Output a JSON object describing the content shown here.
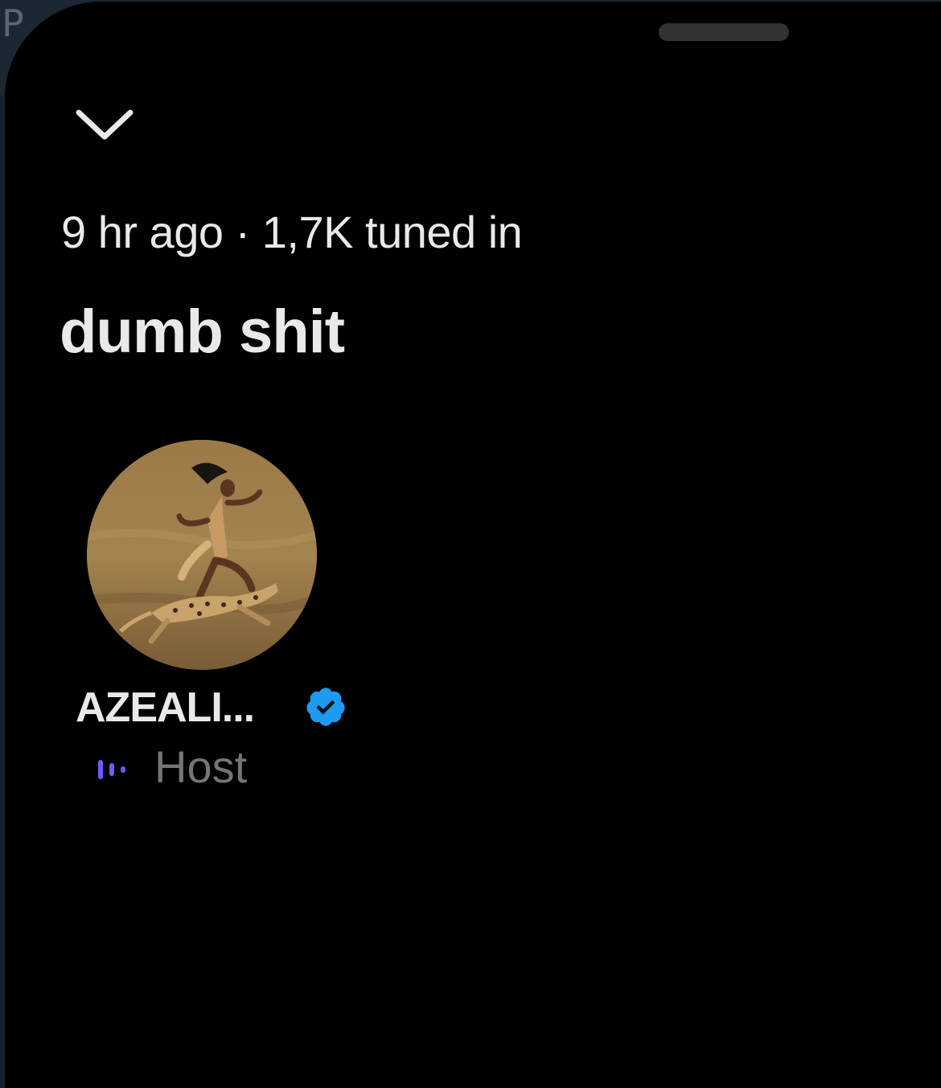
{
  "background": {
    "partial_letter": "P"
  },
  "sheet": {
    "collapse_icon": "chevron-down-icon",
    "meta_text": "9 hr ago · 1,7K tuned in",
    "title": "dumb shit"
  },
  "host": {
    "name": "AZEALI...",
    "verified_icon": "verified-badge-icon",
    "speaking_icon": "speaking-bars-icon",
    "role": "Host"
  },
  "colors": {
    "background": "#000000",
    "text_primary": "#e7e9ea",
    "text_secondary": "#71767b",
    "verified_blue": "#1d9bf0",
    "speaking_purple": "#7856ff"
  }
}
